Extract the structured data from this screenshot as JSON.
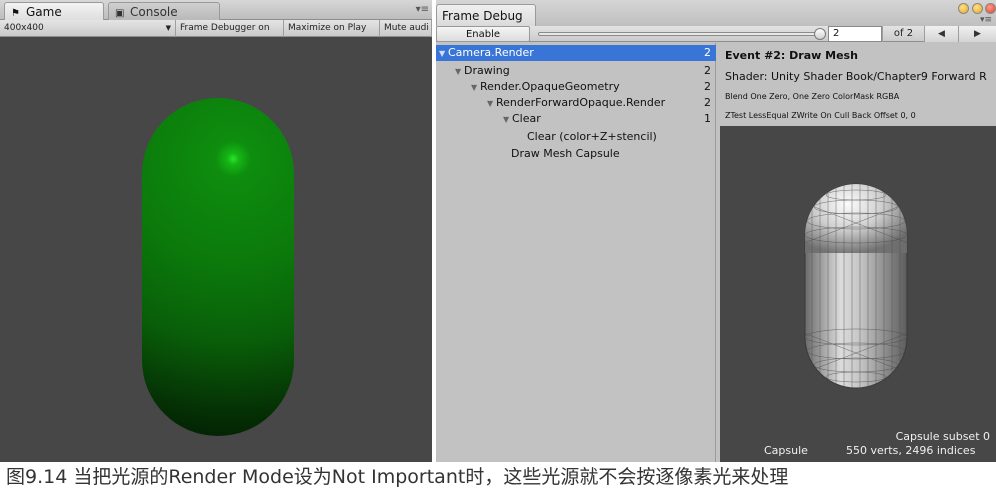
{
  "game_panel": {
    "tabs": [
      {
        "label": "Game",
        "icon": "game-controller-icon"
      },
      {
        "label": "Console",
        "icon": "console-icon"
      }
    ],
    "toolbar": {
      "resolution": "400x400",
      "frame_debugger": "Frame Debugger on",
      "maximize": "Maximize on Play",
      "mute": "Mute audi"
    }
  },
  "frame_debug": {
    "tab_label": "Frame Debug",
    "enable_label": "Enable",
    "frame_value": "2",
    "of_label": "of 2",
    "prev_icon": "◀",
    "next_icon": "▶",
    "slider_fraction": 1.0,
    "tree": [
      {
        "label": "Camera.Render",
        "count": "2",
        "selected": true,
        "foldable": true
      },
      {
        "label": "Drawing",
        "count": "2",
        "foldable": true
      },
      {
        "label": "Render.OpaqueGeometry",
        "count": "2",
        "foldable": true
      },
      {
        "label": "RenderForwardOpaque.Render",
        "count": "2",
        "foldable": true
      },
      {
        "label": "Clear",
        "count": "1",
        "foldable": true
      },
      {
        "label": "Clear (color+Z+stencil)",
        "count": "",
        "foldable": false
      },
      {
        "label": "Draw Mesh Capsule",
        "count": "",
        "foldable": false
      }
    ],
    "event": {
      "title": "Event #2: Draw Mesh",
      "shader": "Shader: Unity Shader Book/Chapter9 Forward R",
      "blend": "Blend One Zero, One Zero ColorMask RGBA",
      "ztest": "ZTest LessEqual ZWrite On Cull Back Offset 0, 0"
    },
    "preview": {
      "subset": "Capsule subset 0",
      "name": "Capsule",
      "stats": "550 verts, 2496 indices"
    }
  },
  "caption": "图9.14 当把光源的Render Mode设为Not Important时，这些光源就不会按逐像素光来处理",
  "colors": {
    "selection": "#3875d7",
    "capsule_green": "#0b780b",
    "viewport_bg": "#474747"
  }
}
